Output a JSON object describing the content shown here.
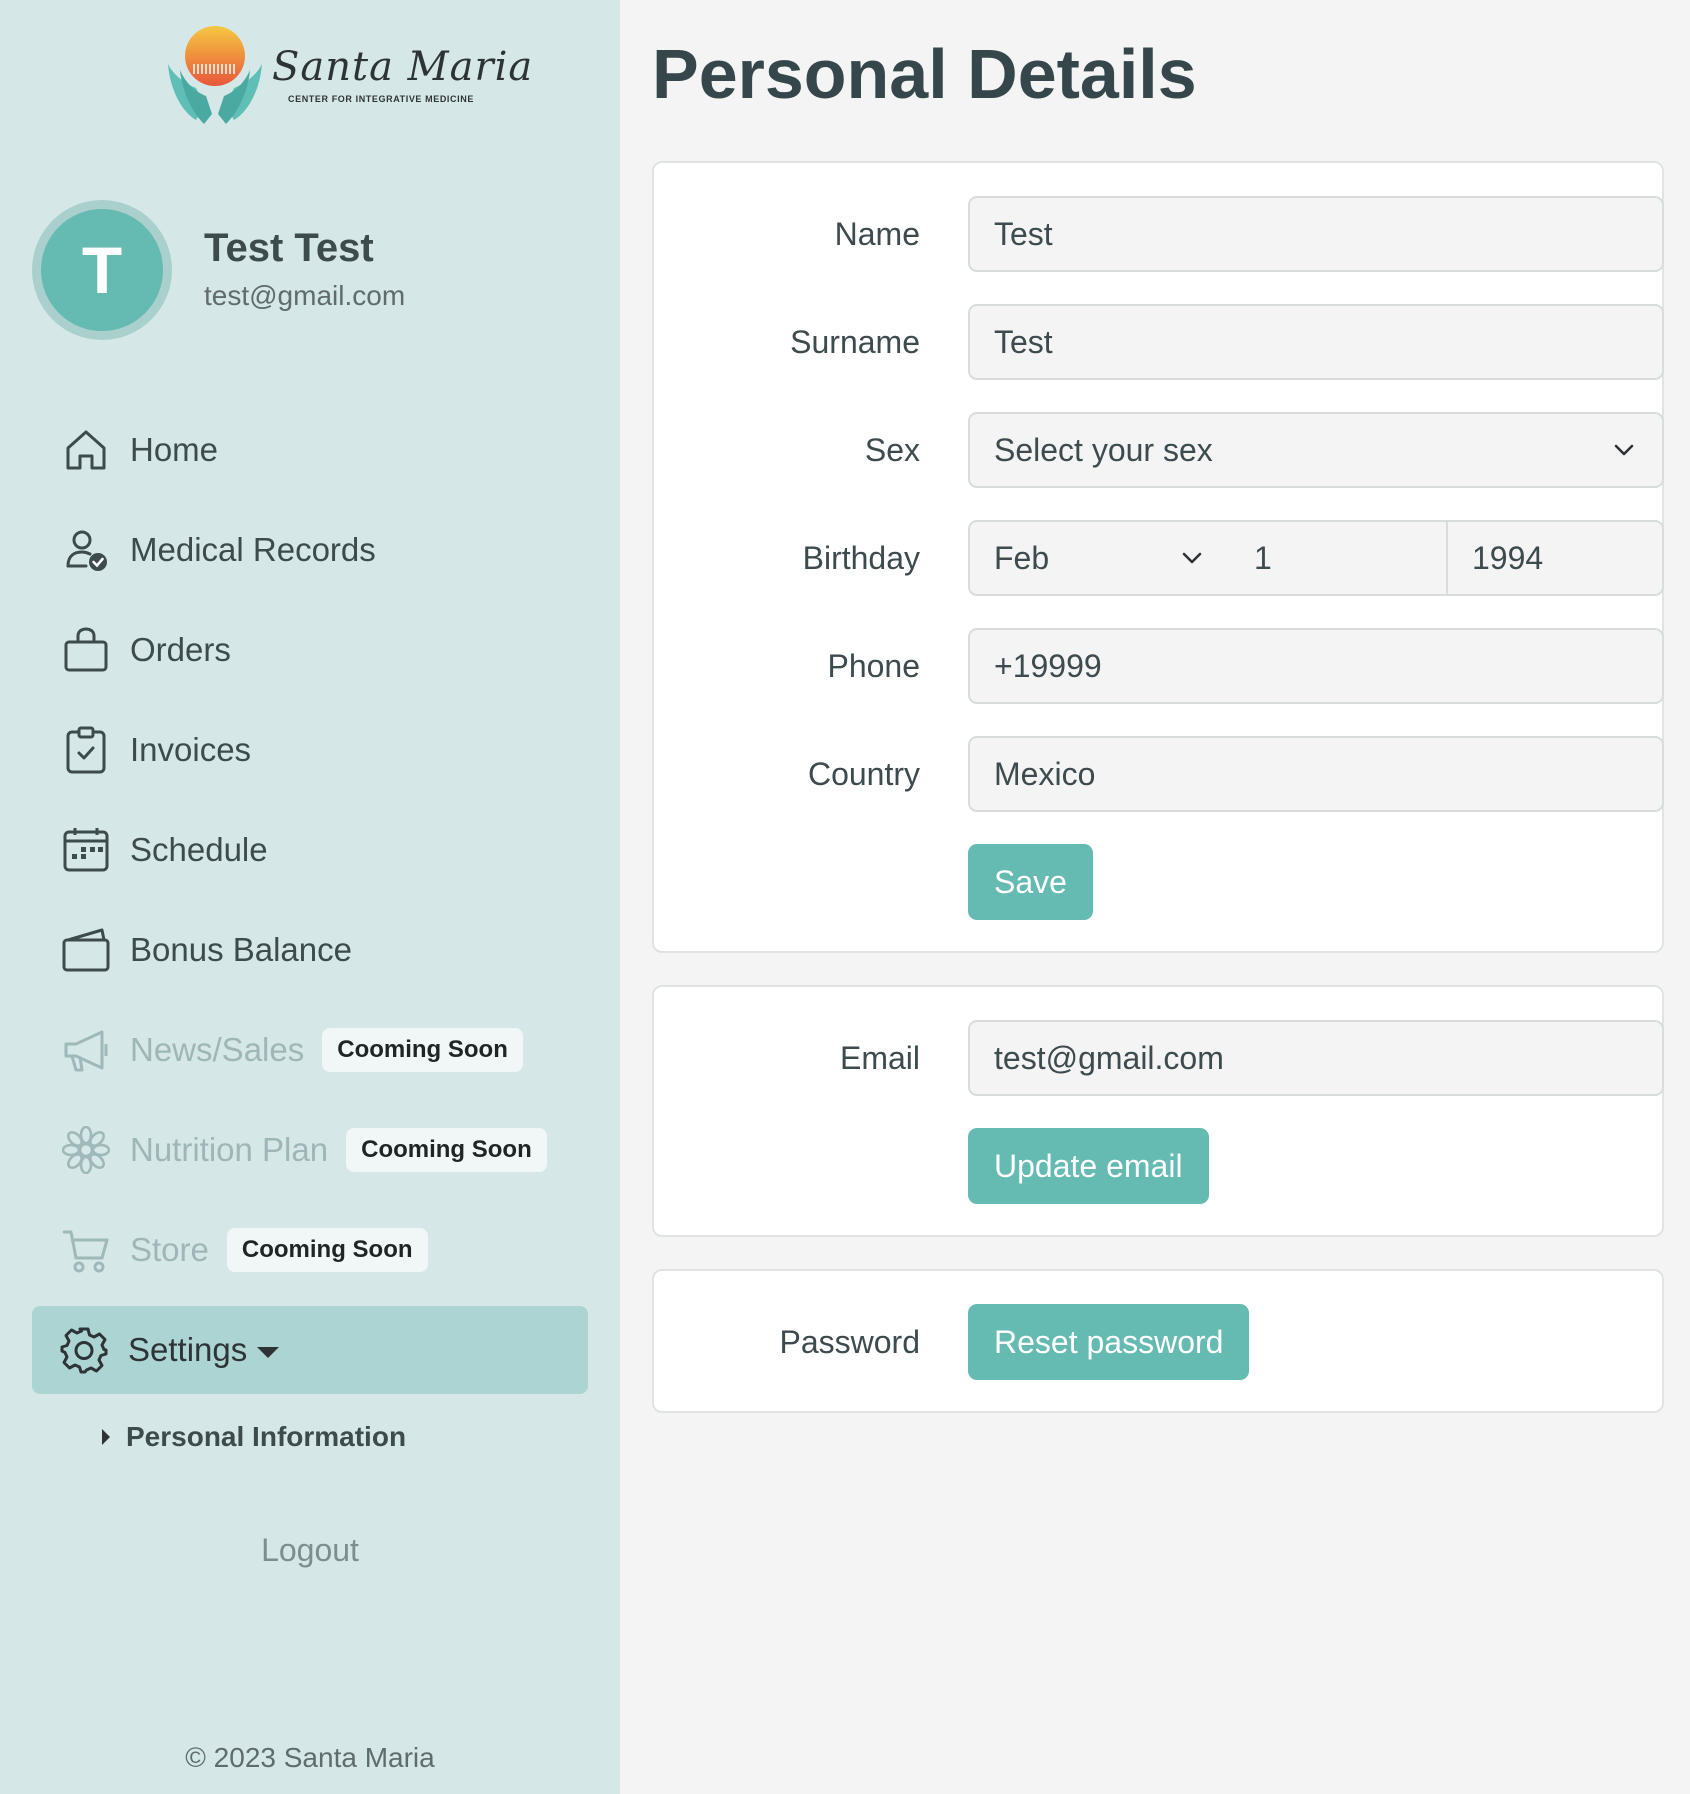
{
  "brand": {
    "script_name": "Santa Maria",
    "tagline": "CENTER FOR INTEGRATIVE MEDICINE",
    "colors": {
      "sun_top": "#f5c842",
      "sun_bottom": "#e8573a",
      "hands": "#5fbfb7"
    }
  },
  "profile": {
    "initial": "T",
    "name": "Test Test",
    "email": "test@gmail.com"
  },
  "nav": {
    "items": [
      {
        "label": "Home",
        "icon": "home-icon"
      },
      {
        "label": "Medical Records",
        "icon": "user-check-icon"
      },
      {
        "label": "Orders",
        "icon": "shopping-bag-icon"
      },
      {
        "label": "Invoices",
        "icon": "clipboard-check-icon"
      },
      {
        "label": "Schedule",
        "icon": "calendar-icon"
      },
      {
        "label": "Bonus Balance",
        "icon": "wallet-icon"
      },
      {
        "label": "News/Sales",
        "icon": "megaphone-icon",
        "badge": "Cooming Soon"
      },
      {
        "label": "Nutrition Plan",
        "icon": "flower-icon",
        "badge": "Cooming Soon"
      },
      {
        "label": "Store",
        "icon": "cart-icon",
        "badge": "Cooming Soon"
      }
    ],
    "settings": {
      "label": "Settings",
      "icon": "gear-icon"
    },
    "sub_items": [
      {
        "label": "Personal Information"
      }
    ],
    "logout": "Logout"
  },
  "footer": {
    "copyright": "© 2023 Santa Maria"
  },
  "page": {
    "title": "Personal Details"
  },
  "personal_form": {
    "name": {
      "label": "Name",
      "value": "Test"
    },
    "surname": {
      "label": "Surname",
      "value": "Test"
    },
    "sex": {
      "label": "Sex",
      "value": "Select your sex"
    },
    "birthday": {
      "label": "Birthday",
      "month": "Feb",
      "day": "1",
      "year": "1994"
    },
    "phone": {
      "label": "Phone",
      "value": "+19999"
    },
    "country": {
      "label": "Country",
      "value": "Mexico"
    },
    "save_label": "Save"
  },
  "email_form": {
    "label": "Email",
    "value": "test@gmail.com",
    "button_label": "Update email"
  },
  "password_form": {
    "label": "Password",
    "button_label": "Reset password"
  },
  "theme": {
    "accent": "#65bab2",
    "sidebar_bg": "#d5e8e7",
    "active_nav_bg": "#acd4d2"
  }
}
